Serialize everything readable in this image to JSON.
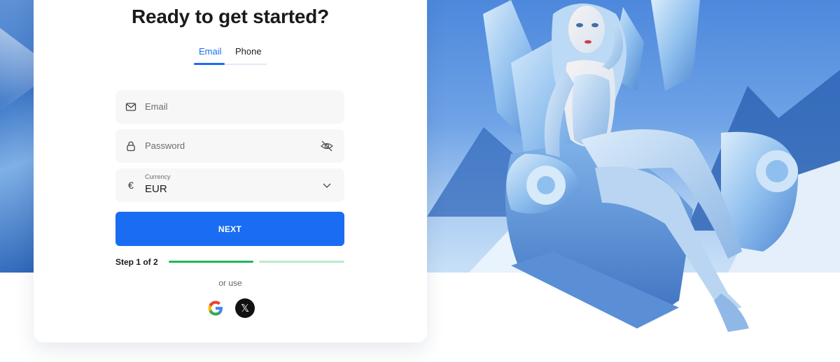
{
  "signup": {
    "title": "Ready to get started?",
    "tabs": [
      {
        "label": "Email",
        "active": true
      },
      {
        "label": "Phone",
        "active": false
      }
    ],
    "email_field": {
      "placeholder": "Email",
      "icon": "mail-icon"
    },
    "password_field": {
      "placeholder": "Password",
      "icon": "lock-icon",
      "toggle_icon": "eye-off-icon"
    },
    "currency_field": {
      "label": "Currency",
      "value": "EUR",
      "symbol": "€",
      "icon": "chevron-down-icon"
    },
    "next_button": "NEXT",
    "step_label": "Step 1 of 2",
    "progress": {
      "current_step": 1,
      "total_steps": 2
    },
    "or_use": "or use",
    "social": [
      {
        "name": "Google",
        "icon": "google-icon"
      },
      {
        "name": "X",
        "icon": "x-icon",
        "glyph": "𝕏"
      }
    ]
  },
  "colors": {
    "accent": "#1a6df2",
    "progress_done": "#1fb85a",
    "progress_pending": "#b8ecc9",
    "hero_background": "#6fa3e6"
  }
}
